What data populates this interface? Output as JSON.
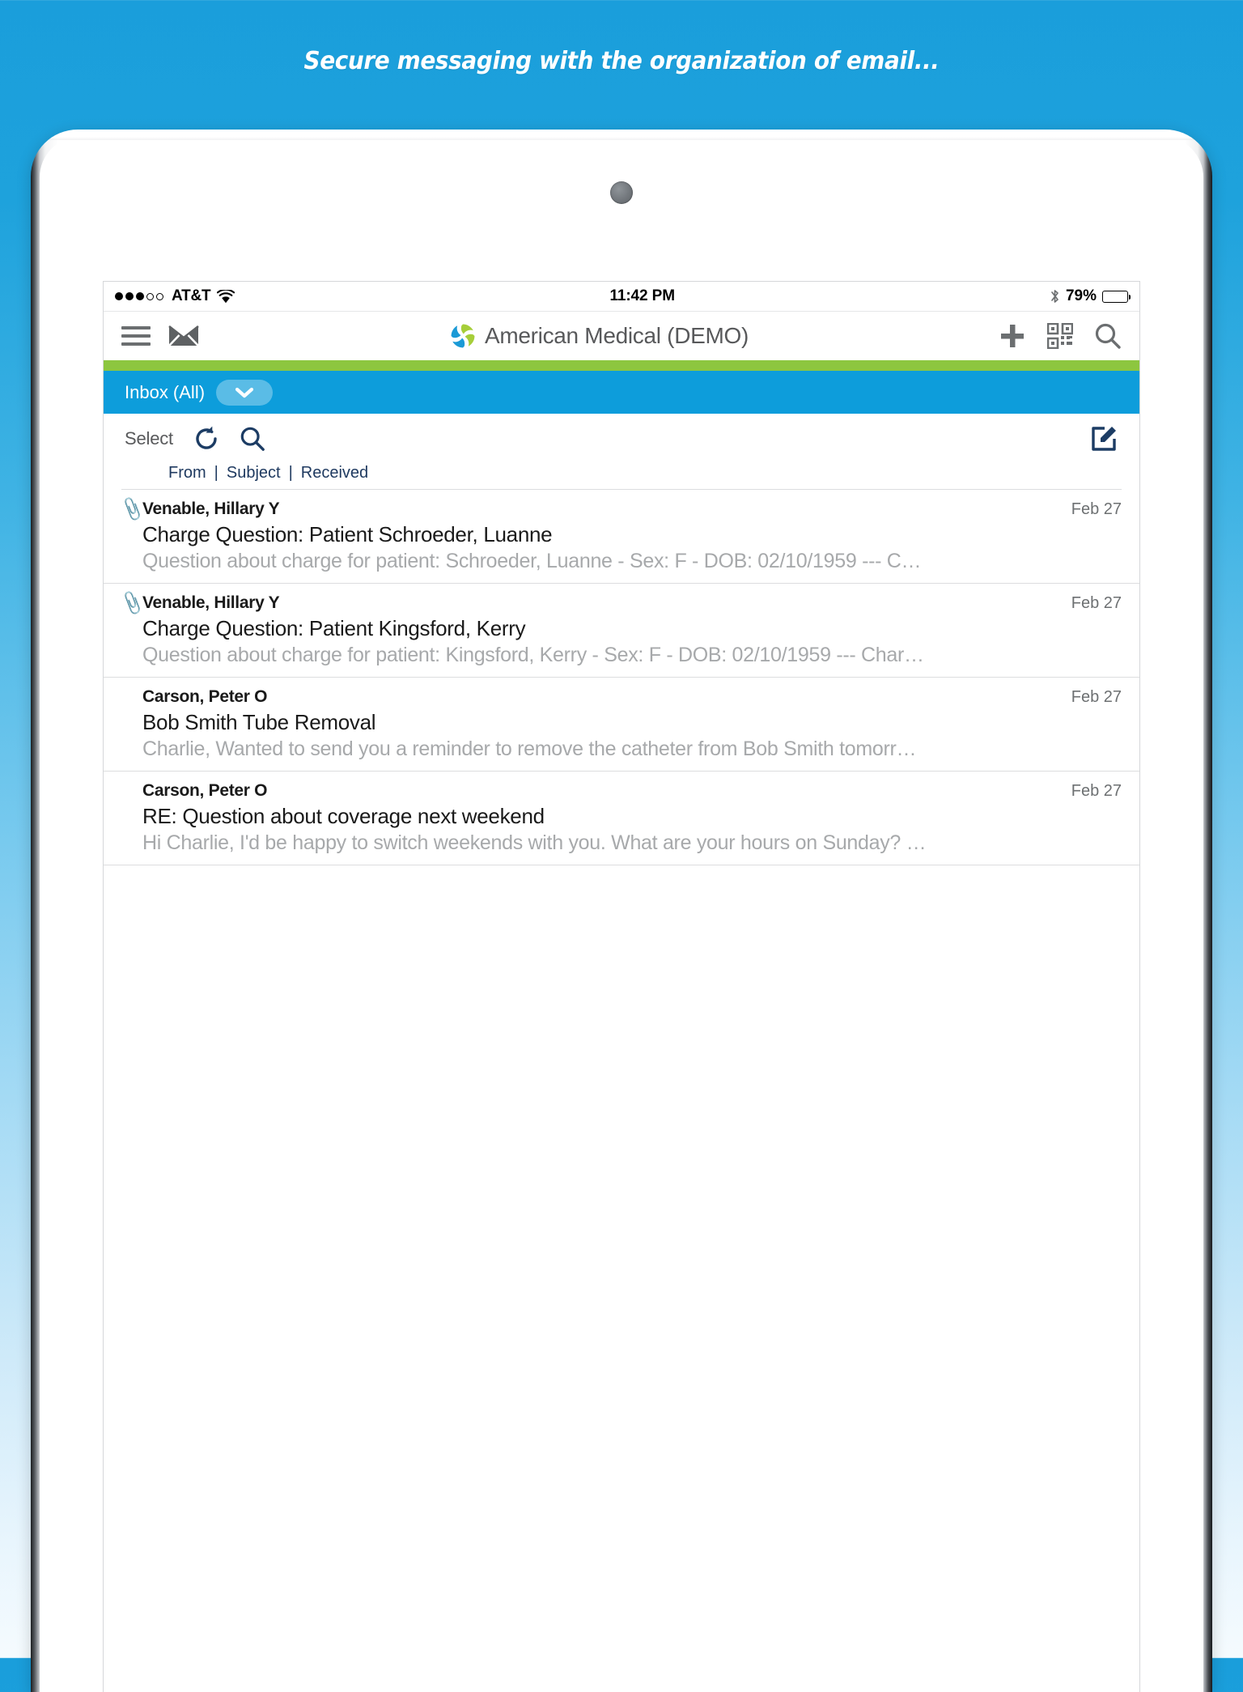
{
  "promo": {
    "headline": "Secure messaging with the organization of email..."
  },
  "status_bar": {
    "carrier": "AT&T",
    "signal_dots_filled": 3,
    "signal_dots_total": 5,
    "wifi_icon": "wifi-icon",
    "time": "11:42 PM",
    "bluetooth_icon": "bluetooth-icon",
    "battery_percent": "79%",
    "battery_level": 79
  },
  "app_bar": {
    "menu_icon": "hamburger-menu-icon",
    "mail_icon": "envelope-icon",
    "logo_icon": "pinwheel-logo-icon",
    "title": "American Medical (DEMO)",
    "add_icon": "plus-icon",
    "qr_icon": "qr-code-icon",
    "search_icon": "search-icon"
  },
  "folder_bar": {
    "label": "Inbox (All)",
    "dropdown_icon": "chevron-down-icon",
    "accent_green": "#8dc63f",
    "accent_blue": "#0d9ddb"
  },
  "toolbar": {
    "select_label": "Select",
    "refresh_icon": "refresh-icon",
    "search_icon": "search-icon",
    "compose_icon": "compose-icon"
  },
  "columns": {
    "from": "From",
    "separator": "|",
    "subject": "Subject",
    "received": "Received"
  },
  "messages": [
    {
      "has_attachment": true,
      "from": "Venable, Hillary Y",
      "subject": "Charge Question: Patient Schroeder, Luanne",
      "preview": "Question about charge for patient: Schroeder, Luanne - Sex: F - DOB: 02/10/1959 --- C…",
      "date": "Feb 27"
    },
    {
      "has_attachment": true,
      "from": "Venable, Hillary Y",
      "subject": "Charge Question: Patient Kingsford, Kerry",
      "preview": "Question about charge for patient: Kingsford, Kerry - Sex: F - DOB: 02/10/1959 --- Char…",
      "date": "Feb 27"
    },
    {
      "has_attachment": false,
      "from": "Carson, Peter O",
      "subject": "Bob Smith Tube Removal",
      "preview": "Charlie, Wanted to send you a reminder to remove the catheter from Bob Smith tomorr…",
      "date": "Feb 27"
    },
    {
      "has_attachment": false,
      "from": "Carson, Peter O",
      "subject": "RE: Question about coverage next weekend",
      "preview": "Hi Charlie, I'd be happy to switch weekends with you. What are your hours on Sunday? …",
      "date": "Feb 27"
    }
  ]
}
